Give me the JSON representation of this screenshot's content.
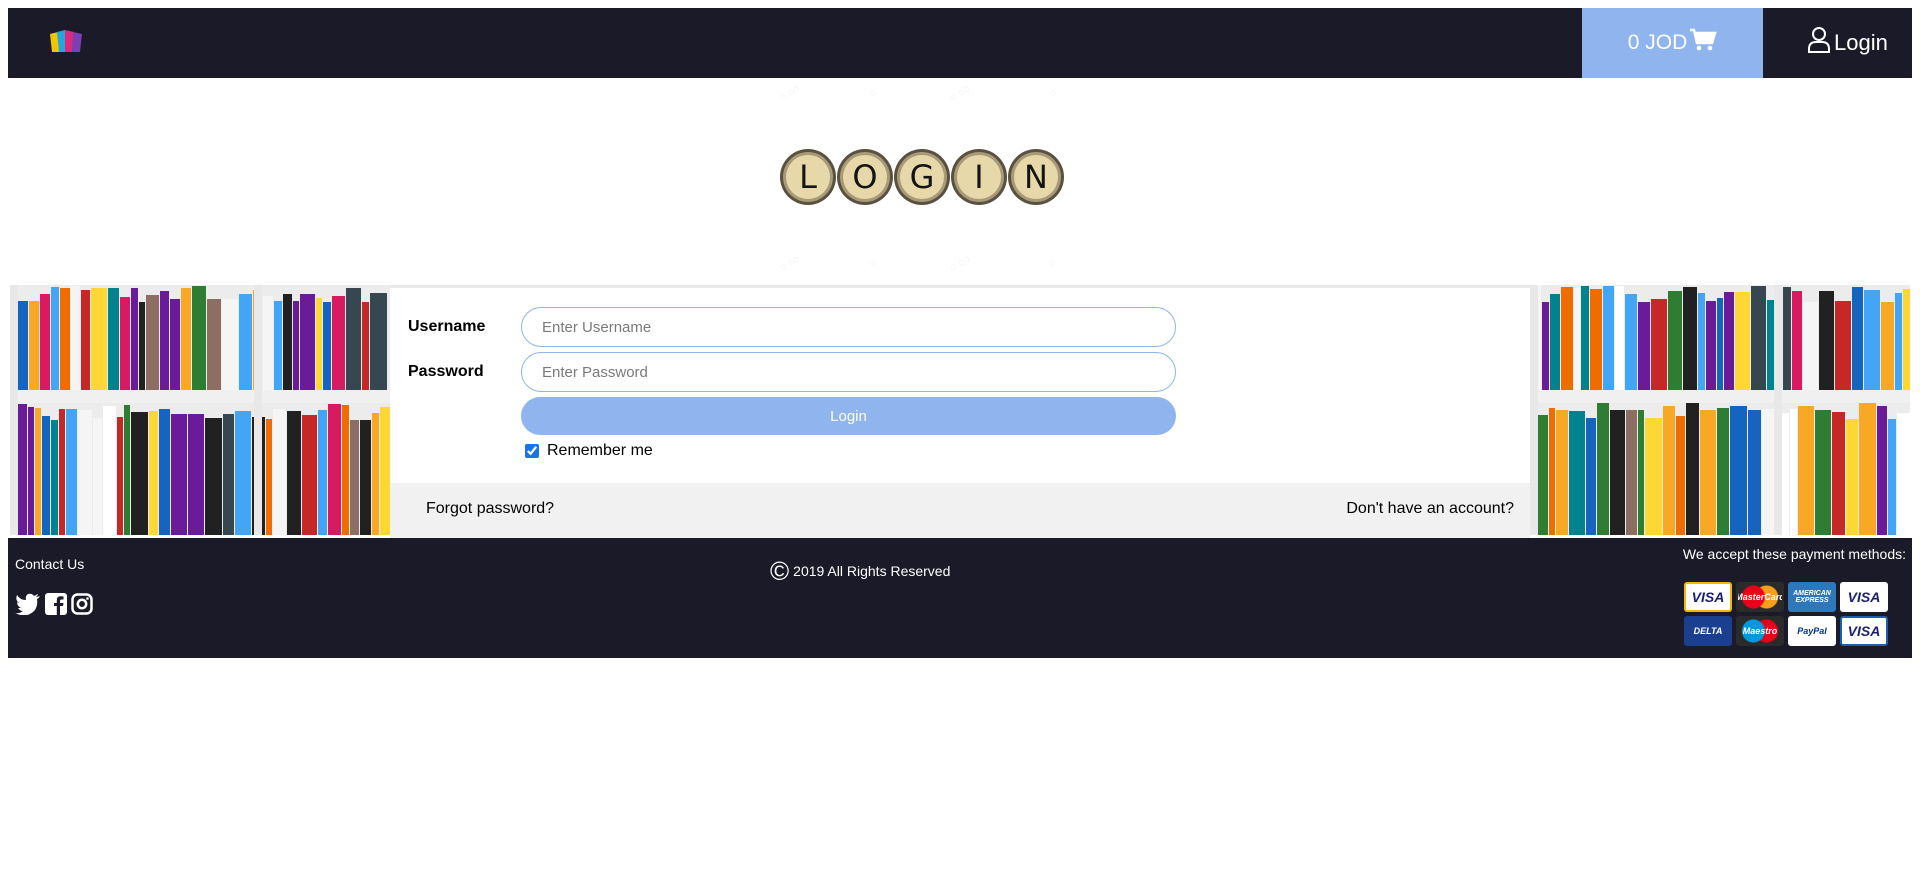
{
  "header": {
    "cart_label": "0 JOD",
    "login_label": "Login",
    "accent_color": "#8fb4ee",
    "bar_color": "#1b1a28"
  },
  "hero": {
    "letters": [
      "L",
      "O",
      "G",
      "I",
      "N"
    ]
  },
  "form": {
    "username_label": "Username",
    "username_placeholder": "Enter Username",
    "password_label": "Password",
    "password_placeholder": "Enter Password",
    "submit_label": "Login",
    "remember_label": "Remember me",
    "remember_checked": true,
    "forgot_label": "Forgot password?",
    "signup_label": "Don't have an account?"
  },
  "footer": {
    "contact_label": "Contact Us",
    "copyright": "2019 All Rights Reserved",
    "payment_title": "We accept these payment methods:",
    "social_icons": [
      "twitter-icon",
      "facebook-icon",
      "instagram-icon"
    ],
    "payment_methods": [
      {
        "label": "VISA",
        "icon": "visa-card-icon"
      },
      {
        "label": "MasterCard",
        "icon": "mastercard-icon"
      },
      {
        "label": "AMERICAN EXPRESS",
        "icon": "amex-icon"
      },
      {
        "label": "VISA",
        "icon": "visa-debit-icon"
      },
      {
        "label": "DELTA",
        "icon": "delta-icon"
      },
      {
        "label": "Maestro",
        "icon": "maestro-icon"
      },
      {
        "label": "PayPal",
        "icon": "paypal-icon"
      },
      {
        "label": "VISA",
        "icon": "visa-electron-icon"
      }
    ]
  }
}
